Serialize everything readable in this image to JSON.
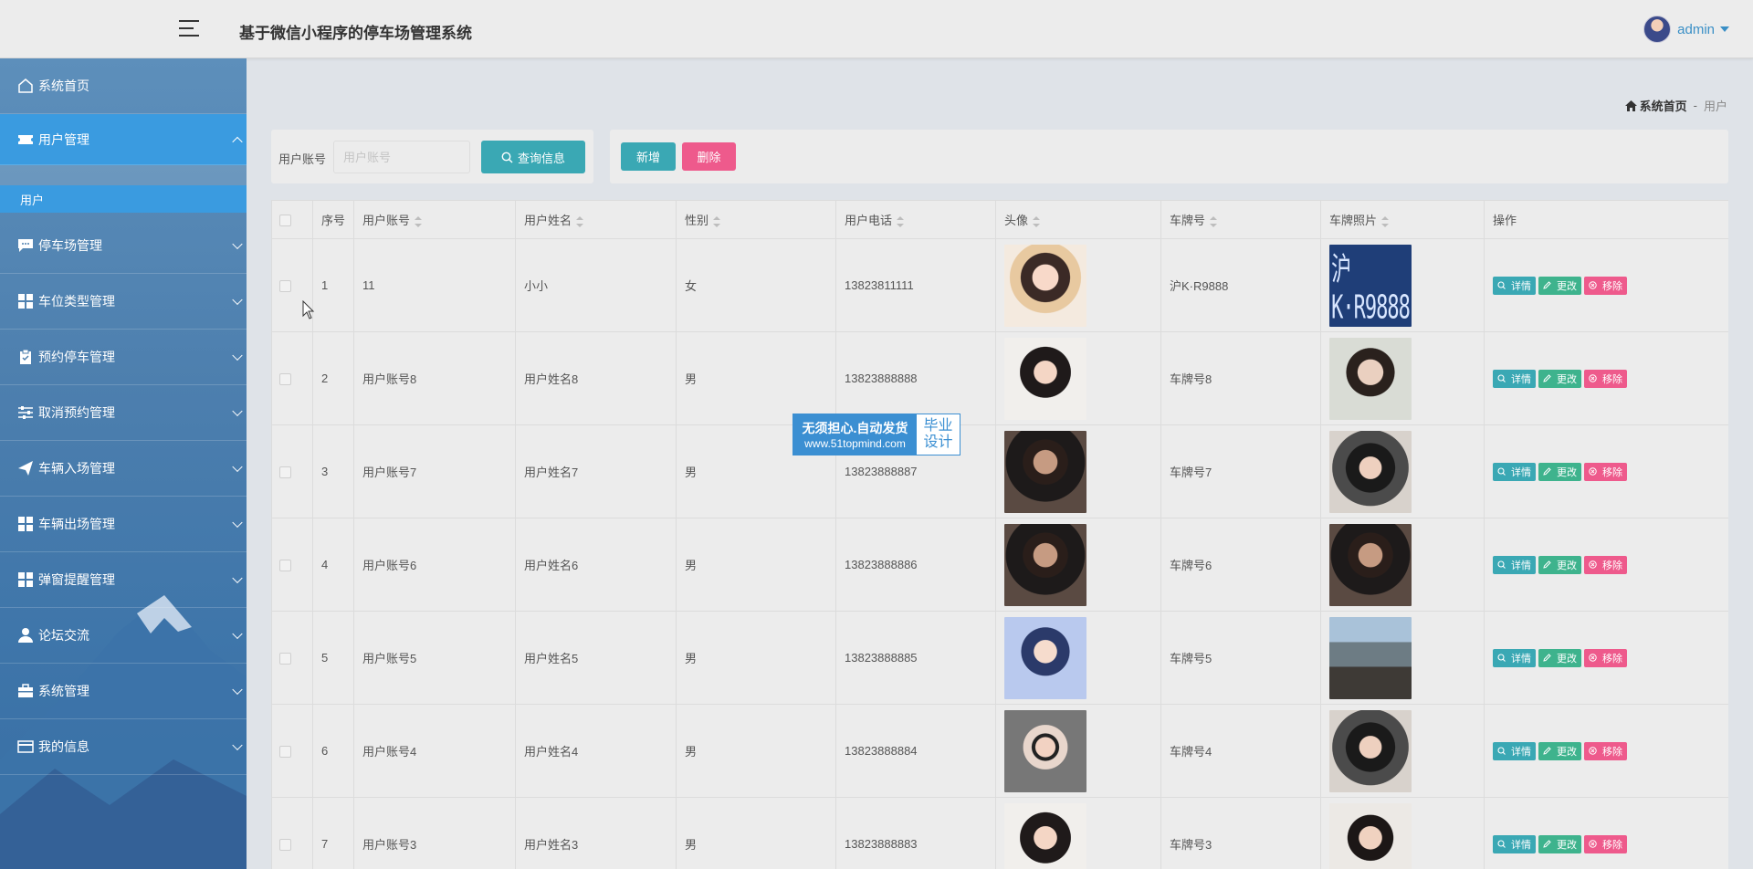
{
  "app": {
    "title": "基于微信小程序的停车场管理系统"
  },
  "user": {
    "name": "admin"
  },
  "sidebar": {
    "items": [
      {
        "label": "系统首页",
        "icon": "home-icon"
      },
      {
        "label": "用户管理",
        "icon": "ticket-icon",
        "active": true,
        "sub": [
          {
            "label": "用户"
          }
        ]
      },
      {
        "label": "停车场管理",
        "icon": "chat-icon"
      },
      {
        "label": "车位类型管理",
        "icon": "grid-icon"
      },
      {
        "label": "预约停车管理",
        "icon": "clipboard-icon"
      },
      {
        "label": "取消预约管理",
        "icon": "sliders-icon"
      },
      {
        "label": "车辆入场管理",
        "icon": "paper-plane-icon"
      },
      {
        "label": "车辆出场管理",
        "icon": "grid-icon"
      },
      {
        "label": "弹窗提醒管理",
        "icon": "grid-icon"
      },
      {
        "label": "论坛交流",
        "icon": "person-icon"
      },
      {
        "label": "系统管理",
        "icon": "briefcase-icon"
      },
      {
        "label": "我的信息",
        "icon": "card-icon"
      }
    ]
  },
  "breadcrumb": {
    "home": "系统首页",
    "separator": "-",
    "current": "用户"
  },
  "search": {
    "label": "用户账号",
    "placeholder": "用户账号",
    "value": "",
    "query_button": "查询信息"
  },
  "actions": {
    "add": "新增",
    "delete": "删除"
  },
  "table": {
    "columns": [
      "序号",
      "用户账号",
      "用户姓名",
      "性别",
      "用户电话",
      "头像",
      "车牌号",
      "车牌照片",
      "操作"
    ],
    "op_labels": {
      "detail": "详情",
      "edit": "更改",
      "remove": "移除"
    },
    "rows": [
      {
        "index": "1",
        "account": "11",
        "name": "小小",
        "gender": "女",
        "phone": "13823811111",
        "plate": "沪K·R9888"
      },
      {
        "index": "2",
        "account": "用户账号8",
        "name": "用户姓名8",
        "gender": "男",
        "phone": "13823888888",
        "plate": "车牌号8"
      },
      {
        "index": "3",
        "account": "用户账号7",
        "name": "用户姓名7",
        "gender": "男",
        "phone": "13823888887",
        "plate": "车牌号7"
      },
      {
        "index": "4",
        "account": "用户账号6",
        "name": "用户姓名6",
        "gender": "男",
        "phone": "13823888886",
        "plate": "车牌号6"
      },
      {
        "index": "5",
        "account": "用户账号5",
        "name": "用户姓名5",
        "gender": "男",
        "phone": "13823888885",
        "plate": "车牌号5"
      },
      {
        "index": "6",
        "account": "用户账号4",
        "name": "用户姓名4",
        "gender": "男",
        "phone": "13823888884",
        "plate": "车牌号4"
      },
      {
        "index": "7",
        "account": "用户账号3",
        "name": "用户姓名3",
        "gender": "男",
        "phone": "13823888883",
        "plate": "车牌号3"
      }
    ],
    "plate_photo_text": "沪K·R9888"
  },
  "watermark": {
    "line1": "无须担心.自动发货",
    "line2": "www.51topmind.com",
    "right1": "毕业",
    "right2": "设计"
  },
  "colors": {
    "sidebar_active": "#3a9be0",
    "teal": "#3aa8b4",
    "green": "#3eb38d",
    "pink": "#ee5a8c",
    "link": "#3a8fc6"
  }
}
